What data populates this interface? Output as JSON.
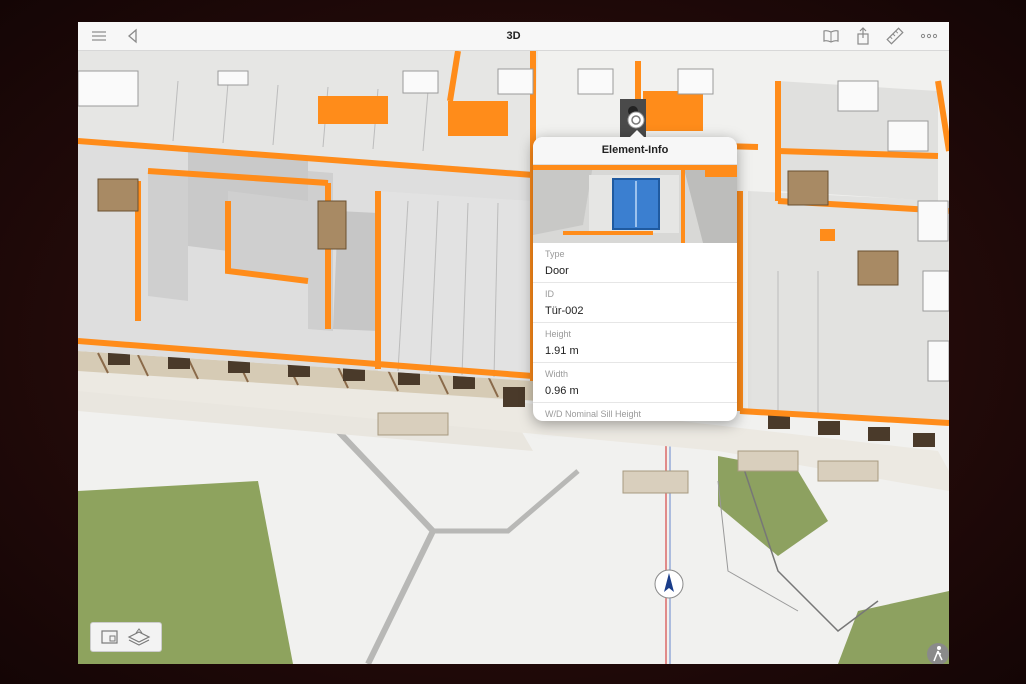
{
  "app": {
    "title": "3D"
  },
  "toolbar": {
    "icons": [
      "list-icon",
      "back-icon",
      "book-icon",
      "share-icon",
      "ruler-icon",
      "more-icon"
    ]
  },
  "element_info": {
    "title": "Element-Info",
    "properties": [
      {
        "label": "Type",
        "value": "Door"
      },
      {
        "label": "ID",
        "value": "Tür-002"
      },
      {
        "label": "Height",
        "value": "1.91 m"
      },
      {
        "label": "Width",
        "value": "0.96 m"
      },
      {
        "label": "W/D Nominal Sill Height",
        "value": ""
      }
    ]
  },
  "bottom_tools": {
    "icons": [
      "floorplan-icon",
      "layers-icon"
    ]
  },
  "colors": {
    "accent": "#ff8c1a",
    "selection": "#3b7fd0",
    "lawn": "#8ea35e"
  }
}
